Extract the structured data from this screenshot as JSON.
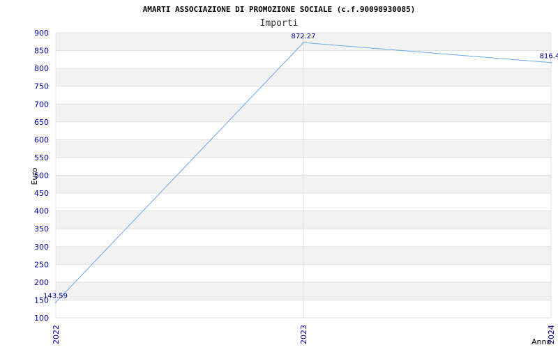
{
  "chart_data": {
    "type": "line",
    "title": "AMARTI ASSOCIAZIONE DI PROMOZIONE SOCIALE (c.f.90098930085)",
    "subtitle": "Importi",
    "xlabel": "Anno",
    "ylabel": "Euro",
    "categories": [
      "2022",
      "2023",
      "2024"
    ],
    "series": [
      {
        "values": [
          143.59,
          872.27,
          816.4
        ],
        "labels": [
          "143.59",
          "872.27",
          "816.4"
        ]
      }
    ],
    "ylim": [
      100,
      900
    ],
    "yticks": [
      100,
      150,
      200,
      250,
      300,
      350,
      400,
      450,
      500,
      550,
      600,
      650,
      700,
      750,
      800,
      850,
      900
    ],
    "grid": true,
    "colors": {
      "line": "#6aaaf0",
      "band": "#f2f2f2",
      "tick_text": "#0000aa",
      "data_label": "#000088"
    }
  }
}
